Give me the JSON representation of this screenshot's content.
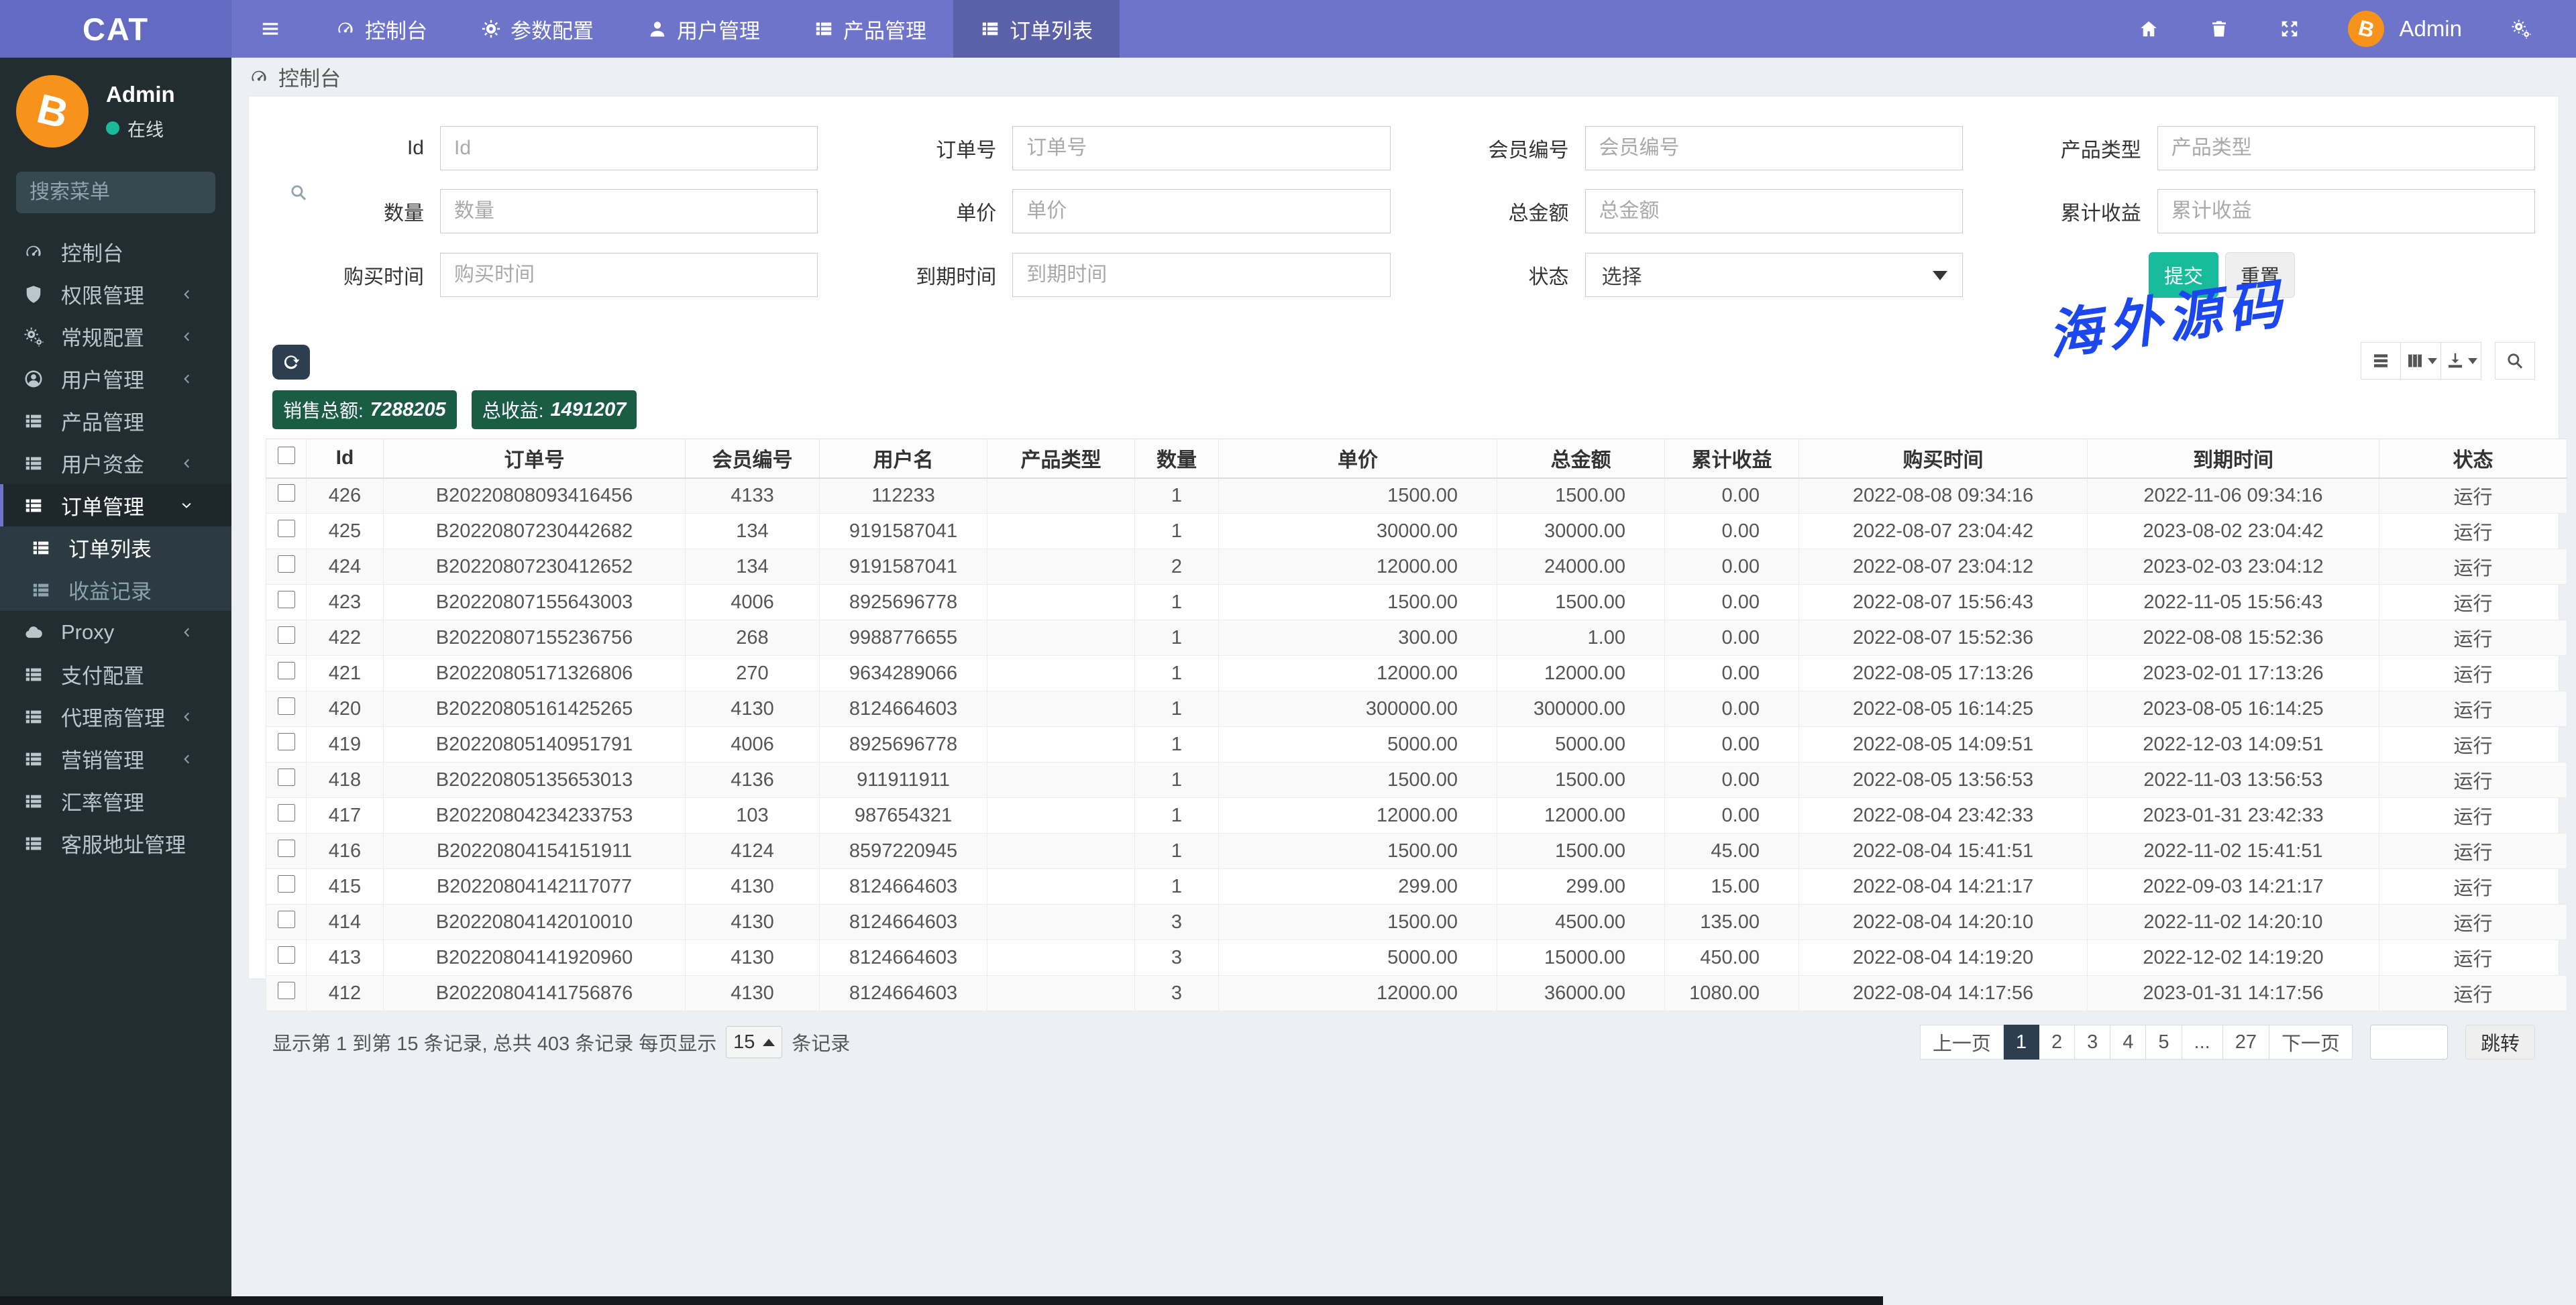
{
  "navbar": {
    "brand": "CAT",
    "items": [
      {
        "icon": "gauge",
        "label": "控制台",
        "active": false
      },
      {
        "icon": "gear",
        "label": "参数配置",
        "active": false
      },
      {
        "icon": "user",
        "label": "用户管理",
        "active": false
      },
      {
        "icon": "th-list",
        "label": "产品管理",
        "active": false
      },
      {
        "icon": "th-list",
        "label": "订单列表",
        "active": true
      }
    ],
    "user_name": "Admin"
  },
  "sidebar": {
    "user": {
      "name": "Admin",
      "status": "在线"
    },
    "search_placeholder": "搜索菜单",
    "items": [
      {
        "icon": "gauge",
        "label": "控制台",
        "arrow": ""
      },
      {
        "icon": "shield",
        "label": "权限管理",
        "arrow": "left"
      },
      {
        "icon": "gears",
        "label": "常规配置",
        "arrow": "left"
      },
      {
        "icon": "user-circle",
        "label": "用户管理",
        "arrow": "left"
      },
      {
        "icon": "th-list",
        "label": "产品管理",
        "arrow": ""
      },
      {
        "icon": "th-list",
        "label": "用户资金",
        "arrow": "left"
      },
      {
        "icon": "th-list",
        "label": "订单管理",
        "arrow": "down",
        "active": true,
        "children": [
          {
            "icon": "th-list",
            "label": "订单列表",
            "active": true
          },
          {
            "icon": "th-list",
            "label": "收益记录",
            "active": false
          }
        ]
      },
      {
        "icon": "cloud",
        "label": "Proxy",
        "arrow": "left"
      },
      {
        "icon": "th-list",
        "label": "支付配置",
        "arrow": ""
      },
      {
        "icon": "th-list",
        "label": "代理商管理",
        "arrow": "left"
      },
      {
        "icon": "th-list",
        "label": "营销管理",
        "arrow": "left"
      },
      {
        "icon": "th-list",
        "label": "汇率管理",
        "arrow": ""
      },
      {
        "icon": "th-list",
        "label": "客服地址管理",
        "arrow": ""
      }
    ]
  },
  "breadcrumb": {
    "label": "控制台"
  },
  "filters": {
    "rows": [
      [
        {
          "label": "Id",
          "placeholder": "Id",
          "type": "text"
        },
        {
          "label": "订单号",
          "placeholder": "订单号",
          "type": "text"
        },
        {
          "label": "会员编号",
          "placeholder": "会员编号",
          "type": "text"
        },
        {
          "label": "产品类型",
          "placeholder": "产品类型",
          "type": "text"
        }
      ],
      [
        {
          "label": "数量",
          "placeholder": "数量",
          "type": "text"
        },
        {
          "label": "单价",
          "placeholder": "单价",
          "type": "text"
        },
        {
          "label": "总金额",
          "placeholder": "总金额",
          "type": "text"
        },
        {
          "label": "累计收益",
          "placeholder": "累计收益",
          "type": "text"
        }
      ],
      [
        {
          "label": "购买时间",
          "placeholder": "购买时间",
          "type": "text"
        },
        {
          "label": "到期时间",
          "placeholder": "到期时间",
          "type": "text"
        },
        {
          "label": "状态",
          "placeholder": "选择",
          "type": "select"
        },
        {
          "type": "buttons"
        }
      ]
    ],
    "submit_label": "提交",
    "reset_label": "重置"
  },
  "watermark": "海外源码",
  "stats": {
    "sales_label": "销售总额:",
    "sales_value": "7288205",
    "profit_label": "总收益:",
    "profit_value": "1491207"
  },
  "table": {
    "columns": [
      "Id",
      "订单号",
      "会员编号",
      "用户名",
      "产品类型",
      "数量",
      "单价",
      "总金额",
      "累计收益",
      "购买时间",
      "到期时间",
      "状态"
    ],
    "rows": [
      [
        "426",
        "B20220808093416456",
        "4133",
        "112233",
        "",
        "1",
        "1500.00",
        "1500.00",
        "0.00",
        "2022-08-08 09:34:16",
        "2022-11-06 09:34:16",
        "运行"
      ],
      [
        "425",
        "B20220807230442682",
        "134",
        "9191587041",
        "",
        "1",
        "30000.00",
        "30000.00",
        "0.00",
        "2022-08-07 23:04:42",
        "2023-08-02 23:04:42",
        "运行"
      ],
      [
        "424",
        "B20220807230412652",
        "134",
        "9191587041",
        "",
        "2",
        "12000.00",
        "24000.00",
        "0.00",
        "2022-08-07 23:04:12",
        "2023-02-03 23:04:12",
        "运行"
      ],
      [
        "423",
        "B20220807155643003",
        "4006",
        "8925696778",
        "",
        "1",
        "1500.00",
        "1500.00",
        "0.00",
        "2022-08-07 15:56:43",
        "2022-11-05 15:56:43",
        "运行"
      ],
      [
        "422",
        "B20220807155236756",
        "268",
        "9988776655",
        "",
        "1",
        "300.00",
        "1.00",
        "0.00",
        "2022-08-07 15:52:36",
        "2022-08-08 15:52:36",
        "运行"
      ],
      [
        "421",
        "B20220805171326806",
        "270",
        "9634289066",
        "",
        "1",
        "12000.00",
        "12000.00",
        "0.00",
        "2022-08-05 17:13:26",
        "2023-02-01 17:13:26",
        "运行"
      ],
      [
        "420",
        "B20220805161425265",
        "4130",
        "8124664603",
        "",
        "1",
        "300000.00",
        "300000.00",
        "0.00",
        "2022-08-05 16:14:25",
        "2023-08-05 16:14:25",
        "运行"
      ],
      [
        "419",
        "B20220805140951791",
        "4006",
        "8925696778",
        "",
        "1",
        "5000.00",
        "5000.00",
        "0.00",
        "2022-08-05 14:09:51",
        "2022-12-03 14:09:51",
        "运行"
      ],
      [
        "418",
        "B20220805135653013",
        "4136",
        "911911911",
        "",
        "1",
        "1500.00",
        "1500.00",
        "0.00",
        "2022-08-05 13:56:53",
        "2022-11-03 13:56:53",
        "运行"
      ],
      [
        "417",
        "B20220804234233753",
        "103",
        "987654321",
        "",
        "1",
        "12000.00",
        "12000.00",
        "0.00",
        "2022-08-04 23:42:33",
        "2023-01-31 23:42:33",
        "运行"
      ],
      [
        "416",
        "B20220804154151911",
        "4124",
        "8597220945",
        "",
        "1",
        "1500.00",
        "1500.00",
        "45.00",
        "2022-08-04 15:41:51",
        "2022-11-02 15:41:51",
        "运行"
      ],
      [
        "415",
        "B20220804142117077",
        "4130",
        "8124664603",
        "",
        "1",
        "299.00",
        "299.00",
        "15.00",
        "2022-08-04 14:21:17",
        "2022-09-03 14:21:17",
        "运行"
      ],
      [
        "414",
        "B20220804142010010",
        "4130",
        "8124664603",
        "",
        "3",
        "1500.00",
        "4500.00",
        "135.00",
        "2022-08-04 14:20:10",
        "2022-11-02 14:20:10",
        "运行"
      ],
      [
        "413",
        "B20220804141920960",
        "4130",
        "8124664603",
        "",
        "3",
        "5000.00",
        "15000.00",
        "450.00",
        "2022-08-04 14:19:20",
        "2022-12-02 14:19:20",
        "运行"
      ],
      [
        "412",
        "B20220804141756876",
        "4130",
        "8124664603",
        "",
        "3",
        "12000.00",
        "36000.00",
        "1080.00",
        "2022-08-04 14:17:56",
        "2023-01-31 14:17:56",
        "运行"
      ]
    ]
  },
  "pagination": {
    "info_prefix": "显示第 1 到第 15 条记录, 总共 403 条记录 每页显示",
    "page_size": "15",
    "info_suffix": "条记录",
    "pages": [
      "上一页",
      "1",
      "2",
      "3",
      "4",
      "5",
      "...",
      "27",
      "下一页"
    ],
    "active_page": "1",
    "jump_label": "跳转"
  },
  "colors": {
    "navbar": "#6d74c9",
    "sidebar": "#222d32",
    "badge_green": "#1a5c44",
    "submit_green": "#18bc9c",
    "pagination_active": "#2c3e50",
    "watermark_blue": "#1c46ee",
    "avatar_orange": "#f7931a",
    "online_dot": "#18bc9c"
  }
}
